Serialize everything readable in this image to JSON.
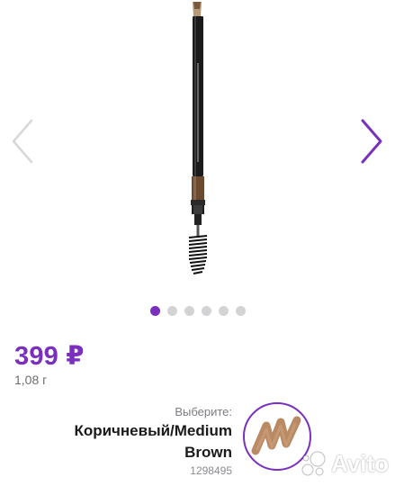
{
  "gallery": {
    "image_alt": "eyebrow-pencil",
    "total_slides": 6,
    "active_slide": 1,
    "prev_icon": "chevron-left-icon",
    "next_icon": "chevron-right-icon"
  },
  "product": {
    "price": "399 ₽",
    "weight": "1,08 г"
  },
  "shade": {
    "choose_label": "Выберите:",
    "name": "Коричневый/Medium Brown",
    "sku": "1298495"
  },
  "watermark": {
    "text": "Avito"
  },
  "colors": {
    "accent": "#7a2fbf",
    "dot_inactive": "#d3d3d6",
    "shade_swatch": "#b98a63"
  }
}
